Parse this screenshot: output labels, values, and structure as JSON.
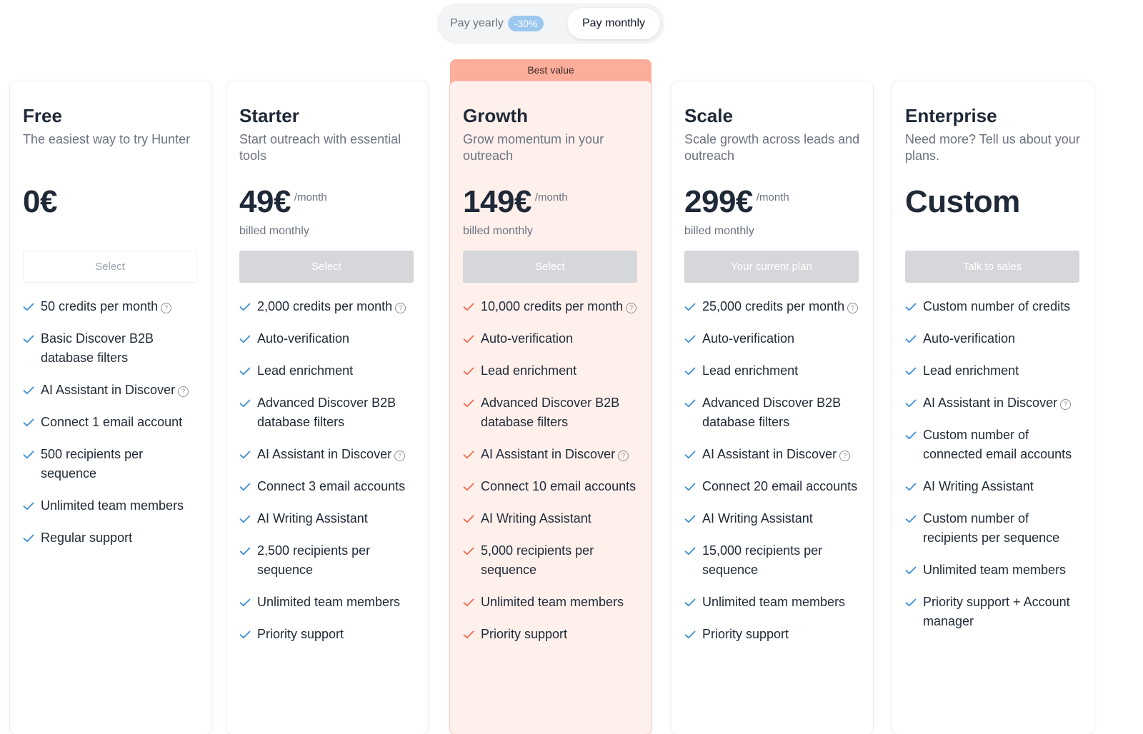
{
  "billing_toggle": {
    "yearly_label": "Pay yearly",
    "discount_badge": "-30%",
    "monthly_label": "Pay monthly",
    "selected": "monthly"
  },
  "best_value_label": "Best value",
  "colors": {
    "check_blue": "#3b8ed8",
    "check_orange": "#f26a4b",
    "highlight_bg": "#fff0ec",
    "banner_bg": "#fdae9b"
  },
  "plans": [
    {
      "name": "Free",
      "description": "The easiest way to try Hunter",
      "price": "0€",
      "per": "",
      "billed": "",
      "cta": "Select",
      "features": [
        {
          "text": "50 credits per month",
          "help": true
        },
        {
          "text": "Basic Discover B2B database filters",
          "help": false
        },
        {
          "text": "AI Assistant in Discover",
          "help": true
        },
        {
          "text": "Connect 1 email account",
          "help": false
        },
        {
          "text": "500 recipients per sequence",
          "help": false
        },
        {
          "text": "Unlimited team members",
          "help": false
        },
        {
          "text": "Regular support",
          "help": false
        }
      ]
    },
    {
      "name": "Starter",
      "description": "Start outreach with essential tools",
      "price": "49€",
      "per": "/month",
      "billed": "billed monthly",
      "cta": "Select",
      "features": [
        {
          "text": "2,000 credits per month",
          "help": true
        },
        {
          "text": "Auto-verification",
          "help": false
        },
        {
          "text": "Lead enrichment",
          "help": false
        },
        {
          "text": "Advanced Discover B2B database filters",
          "help": false
        },
        {
          "text": "AI Assistant in Discover",
          "help": true
        },
        {
          "text": "Connect 3 email accounts",
          "help": false
        },
        {
          "text": "AI Writing Assistant",
          "help": false
        },
        {
          "text": "2,500 recipients per sequence",
          "help": false
        },
        {
          "text": "Unlimited team members",
          "help": false
        },
        {
          "text": "Priority support",
          "help": false
        }
      ]
    },
    {
      "name": "Growth",
      "description": "Grow momentum in your outreach",
      "price": "149€",
      "per": "/month",
      "billed": "billed monthly",
      "cta": "Select",
      "features": [
        {
          "text": "10,000 credits per month",
          "help": true
        },
        {
          "text": "Auto-verification",
          "help": false
        },
        {
          "text": "Lead enrichment",
          "help": false
        },
        {
          "text": "Advanced Discover B2B database filters",
          "help": false
        },
        {
          "text": "AI Assistant in Discover",
          "help": true
        },
        {
          "text": "Connect 10 email accounts",
          "help": false
        },
        {
          "text": "AI Writing Assistant",
          "help": false
        },
        {
          "text": "5,000 recipients per sequence",
          "help": false
        },
        {
          "text": "Unlimited team members",
          "help": false
        },
        {
          "text": "Priority support",
          "help": false
        }
      ]
    },
    {
      "name": "Scale",
      "description": "Scale growth across leads and outreach",
      "price": "299€",
      "per": "/month",
      "billed": "billed monthly",
      "cta": "Your current plan",
      "features": [
        {
          "text": "25,000 credits per month",
          "help": true
        },
        {
          "text": "Auto-verification",
          "help": false
        },
        {
          "text": "Lead enrichment",
          "help": false
        },
        {
          "text": "Advanced Discover B2B database filters",
          "help": false
        },
        {
          "text": "AI Assistant in Discover",
          "help": true
        },
        {
          "text": "Connect 20 email accounts",
          "help": false
        },
        {
          "text": "AI Writing Assistant",
          "help": false
        },
        {
          "text": "15,000 recipients per sequence",
          "help": false
        },
        {
          "text": "Unlimited team members",
          "help": false
        },
        {
          "text": "Priority support",
          "help": false
        }
      ]
    },
    {
      "name": "Enterprise",
      "description": "Need more? Tell us about your plans.",
      "price": "Custom",
      "per": "",
      "billed": "",
      "cta": "Talk to sales",
      "features": [
        {
          "text": "Custom number of credits",
          "help": false
        },
        {
          "text": "Auto-verification",
          "help": false
        },
        {
          "text": "Lead enrichment",
          "help": false
        },
        {
          "text": "AI Assistant in Discover",
          "help": true
        },
        {
          "text": "Custom number of connected email accounts",
          "help": false
        },
        {
          "text": "AI Writing Assistant",
          "help": false
        },
        {
          "text": "Custom number of recipients per sequence",
          "help": false
        },
        {
          "text": "Unlimited team members",
          "help": false
        },
        {
          "text": "Priority support + Account manager",
          "help": false
        }
      ]
    }
  ]
}
